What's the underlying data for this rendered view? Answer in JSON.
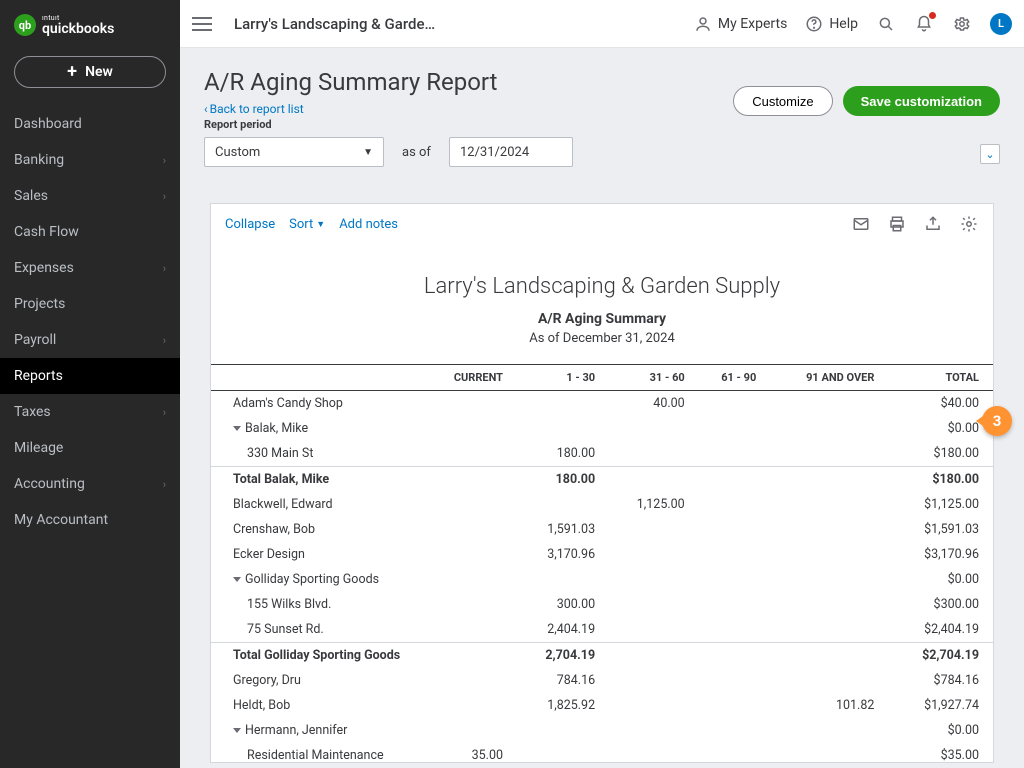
{
  "topbar": {
    "company": "Larry's Landscaping & Garde…",
    "my_experts": "My Experts",
    "help": "Help",
    "avatar_initial": "L"
  },
  "sidebar": {
    "brand_small": "ıntuıt",
    "brand_big": "quickbooks",
    "new_label": "New",
    "items": [
      {
        "label": "Dashboard",
        "chev": false
      },
      {
        "label": "Banking",
        "chev": true
      },
      {
        "label": "Sales",
        "chev": true
      },
      {
        "label": "Cash Flow",
        "chev": false
      },
      {
        "label": "Expenses",
        "chev": true
      },
      {
        "label": "Projects",
        "chev": false
      },
      {
        "label": "Payroll",
        "chev": true
      },
      {
        "label": "Reports",
        "chev": false,
        "active": true
      },
      {
        "label": "Taxes",
        "chev": true
      },
      {
        "label": "Mileage",
        "chev": false
      },
      {
        "label": "Accounting",
        "chev": true
      },
      {
        "label": "My Accountant",
        "chev": false
      }
    ]
  },
  "page": {
    "title": "A/R Aging Summary Report",
    "back_link": "Back to report list",
    "period_label": "Report period",
    "period_select": "Custom",
    "asof_label": "as of",
    "asof_date": "12/31/2024",
    "customize_btn": "Customize",
    "save_btn": "Save customization"
  },
  "toolbar": {
    "collapse": "Collapse",
    "sort": "Sort",
    "add_notes": "Add notes"
  },
  "report": {
    "company": "Larry's Landscaping & Garden Supply",
    "name": "A/R Aging Summary",
    "asof": "As of December 31, 2024",
    "columns": [
      "",
      "CURRENT",
      "1 - 30",
      "31 - 60",
      "61 - 90",
      "91 AND OVER",
      "TOTAL"
    ],
    "rows": [
      {
        "type": "data",
        "label": "Adam's Candy Shop",
        "current": "",
        "c1_30": "",
        "c31_60": "40.00",
        "c61_90": "",
        "c91": "",
        "total": "$40.00"
      },
      {
        "type": "group",
        "label": "Balak, Mike",
        "total": "$0.00"
      },
      {
        "type": "child",
        "label": "330 Main St",
        "c1_30": "180.00",
        "total": "$180.00"
      },
      {
        "type": "total",
        "label": "Total Balak, Mike",
        "c1_30": "180.00",
        "total": "$180.00"
      },
      {
        "type": "data",
        "label": "Blackwell, Edward",
        "c31_60": "1,125.00",
        "total": "$1,125.00"
      },
      {
        "type": "data",
        "label": "Crenshaw, Bob",
        "c1_30": "1,591.03",
        "total": "$1,591.03"
      },
      {
        "type": "data",
        "label": "Ecker Design",
        "c1_30": "3,170.96",
        "total": "$3,170.96"
      },
      {
        "type": "group",
        "label": "Golliday Sporting Goods",
        "total": "$0.00"
      },
      {
        "type": "child",
        "label": "155 Wilks Blvd.",
        "c1_30": "300.00",
        "total": "$300.00"
      },
      {
        "type": "child",
        "label": "75 Sunset Rd.",
        "c1_30": "2,404.19",
        "total": "$2,404.19"
      },
      {
        "type": "total",
        "label": "Total Golliday Sporting Goods",
        "c1_30": "2,704.19",
        "total": "$2,704.19"
      },
      {
        "type": "data",
        "label": "Gregory, Dru",
        "c1_30": "784.16",
        "total": "$784.16"
      },
      {
        "type": "data",
        "label": "Heldt, Bob",
        "c1_30": "1,825.92",
        "c91": "101.82",
        "total": "$1,927.74"
      },
      {
        "type": "group",
        "label": "Hermann, Jennifer",
        "total": "$0.00"
      },
      {
        "type": "child",
        "label": "Residential Maintenance",
        "current": "35.00",
        "total": "$35.00"
      }
    ]
  },
  "callout": "3"
}
